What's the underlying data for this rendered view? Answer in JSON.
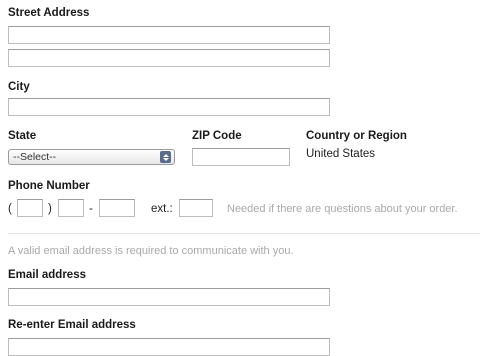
{
  "address": {
    "street_label": "Street Address",
    "street_line1_value": "",
    "street_line2_value": "",
    "city_label": "City",
    "city_value": ""
  },
  "state": {
    "label": "State",
    "selected": "--Select--"
  },
  "zip": {
    "label": "ZIP Code",
    "value": ""
  },
  "country": {
    "label": "Country or Region",
    "value": "United States"
  },
  "phone": {
    "label": "Phone Number",
    "open_paren": "(",
    "close_paren": ")",
    "dash": "-",
    "ext_label": "ext.:",
    "hint": "Needed if there are questions about your order."
  },
  "email": {
    "notice": "A valid email address is required to communicate with you.",
    "label": "Email address",
    "value": "",
    "reenter_label": "Re-enter Email address",
    "reenter_value": ""
  }
}
